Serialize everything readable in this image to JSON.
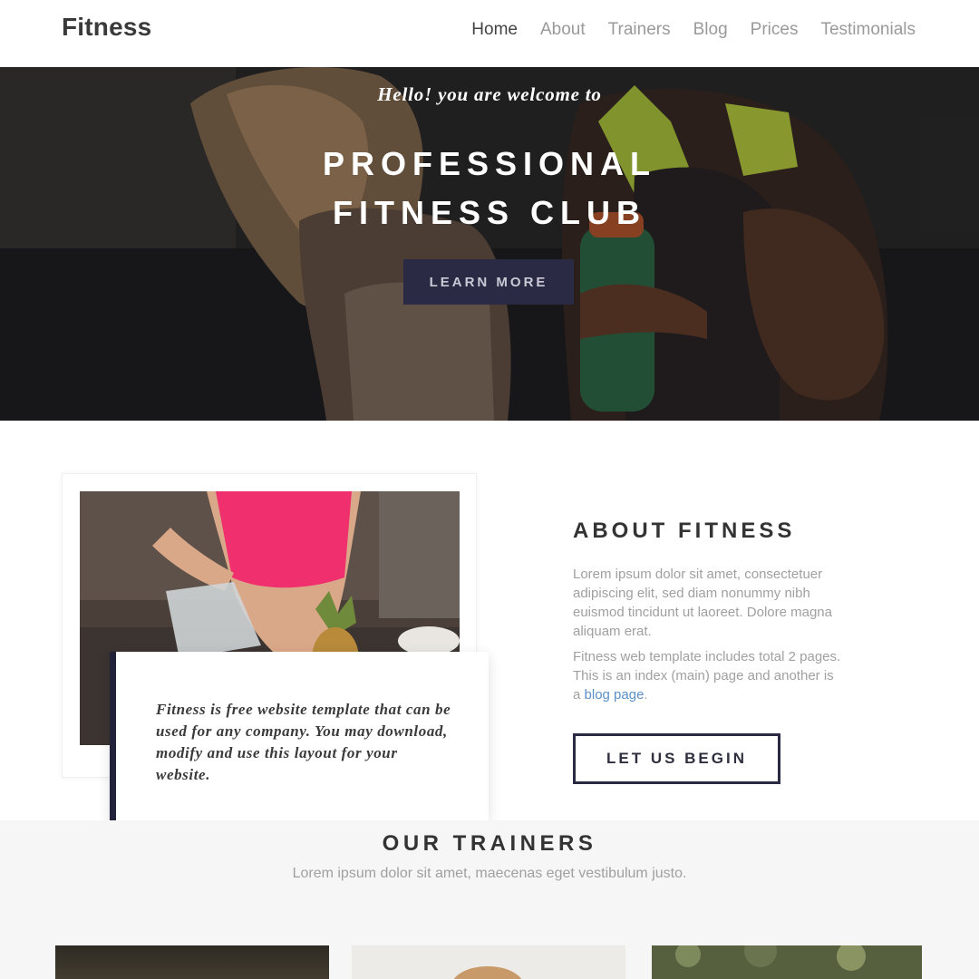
{
  "nav": {
    "brand": "Fitness",
    "items": [
      {
        "label": "Home",
        "active": true
      },
      {
        "label": "About"
      },
      {
        "label": "Trainers"
      },
      {
        "label": "Blog"
      },
      {
        "label": "Prices"
      },
      {
        "label": "Testimonials"
      }
    ]
  },
  "hero": {
    "welcome": "Hello! you are welcome to",
    "title_line1": "PROFESSIONAL",
    "title_line2": "FITNESS CLUB",
    "button": "LEARN MORE"
  },
  "about": {
    "quote": "Fitness is free website template that can be used for any company. You may download, modify and use this layout for your website.",
    "title": "ABOUT FITNESS",
    "p1": "Lorem ipsum dolor sit amet, consectetuer adipiscing elit, sed diam nonummy nibh euismod tincidunt ut laoreet. Dolore magna aliquam erat.",
    "p2_text": "Fitness web template includes total 2 pages. This is an index (main) page and another is a",
    "p2_link": "blog page",
    "p2_end": ".",
    "button": "LET US BEGIN"
  },
  "trainers": {
    "title": "OUR TRAINERS",
    "subtitle": "Lorem ipsum dolor sit amet, maecenas eget vestibulum justo."
  },
  "colors": {
    "accent_dark": "#2a2a44",
    "link": "#5b8fc7",
    "muted_text": "#a0a0a0"
  }
}
